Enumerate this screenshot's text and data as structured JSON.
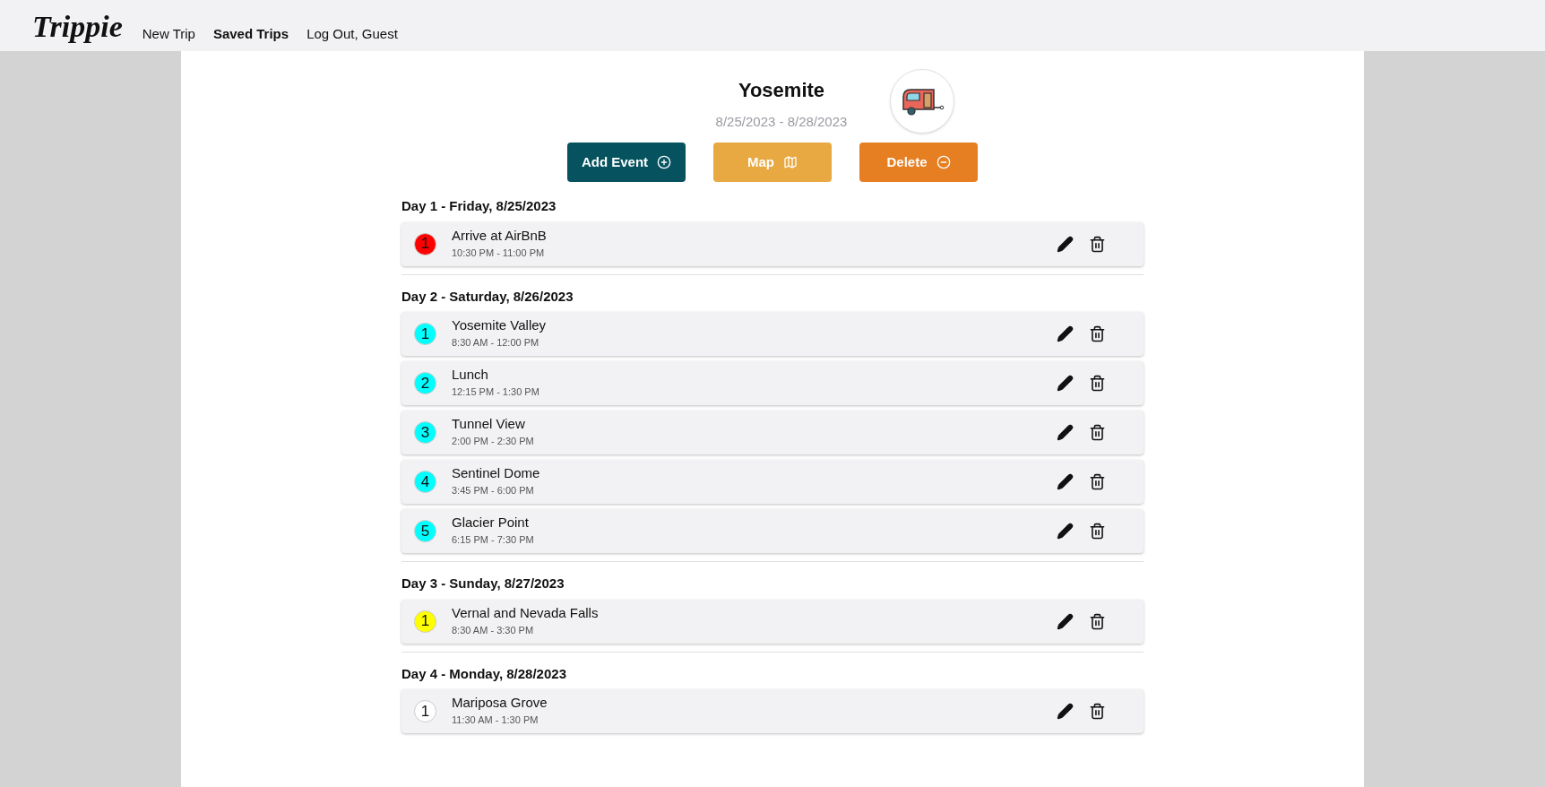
{
  "nav": {
    "logo": "Trippie",
    "links": [
      {
        "label": "New Trip",
        "selected": false
      },
      {
        "label": "Saved Trips",
        "selected": true
      },
      {
        "label": "Log Out, Guest",
        "selected": false
      }
    ]
  },
  "trip": {
    "title": "Yosemite",
    "dates": "8/25/2023 - 8/28/2023"
  },
  "actions": [
    {
      "label": "Add Event",
      "kind": "add"
    },
    {
      "label": "Map",
      "kind": "map"
    },
    {
      "label": "Delete",
      "kind": "delete"
    }
  ],
  "days": [
    {
      "heading": "Day 1 - Friday, 8/25/2023",
      "color": "#ff0000",
      "events": [
        {
          "number": "1",
          "name": "Arrive at AirBnB",
          "time": "10:30 PM - 11:00 PM"
        }
      ]
    },
    {
      "heading": "Day 2 - Saturday, 8/26/2023",
      "color": "#00ffff",
      "events": [
        {
          "number": "1",
          "name": "Yosemite Valley",
          "time": "8:30 AM - 12:00 PM"
        },
        {
          "number": "2",
          "name": "Lunch",
          "time": "12:15 PM - 1:30 PM"
        },
        {
          "number": "3",
          "name": "Tunnel View",
          "time": "2:00 PM - 2:30 PM"
        },
        {
          "number": "4",
          "name": "Sentinel Dome",
          "time": "3:45 PM - 6:00 PM"
        },
        {
          "number": "5",
          "name": "Glacier Point",
          "time": "6:15 PM - 7:30 PM"
        }
      ]
    },
    {
      "heading": "Day 3 - Sunday, 8/27/2023",
      "color": "#ffff00",
      "events": [
        {
          "number": "1",
          "name": "Vernal and Nevada Falls",
          "time": "8:30 AM - 3:30 PM"
        }
      ]
    },
    {
      "heading": "Day 4 - Monday, 8/28/2023",
      "color": "#ffffff",
      "events": [
        {
          "number": "1",
          "name": "Mariposa Grove",
          "time": "11:30 AM - 1:30 PM"
        }
      ]
    }
  ]
}
